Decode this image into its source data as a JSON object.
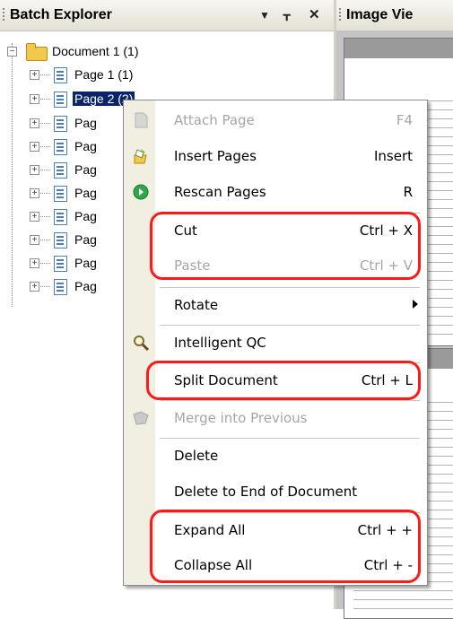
{
  "batch_explorer": {
    "title": "Batch Explorer",
    "dropdown_icon": "▼",
    "pin_icon": "ᚁ",
    "close_icon": "✕"
  },
  "image_viewer": {
    "title": "Image Vie"
  },
  "tree": {
    "root_label": "Document 1 (1)",
    "pages": [
      {
        "label": "Page 1 (1)"
      },
      {
        "label": "Page 2 (2)"
      },
      {
        "label": "Pag"
      },
      {
        "label": "Pag"
      },
      {
        "label": "Pag"
      },
      {
        "label": "Pag"
      },
      {
        "label": "Pag"
      },
      {
        "label": "Pag"
      },
      {
        "label": "Pag"
      },
      {
        "label": "Pag"
      }
    ]
  },
  "context_menu": {
    "items": [
      {
        "label": "Attach Page",
        "shortcut": "F4",
        "icon": "attach-page-icon",
        "disabled": true
      },
      {
        "label": "Insert Pages",
        "shortcut": "Insert",
        "icon": "insert-pages-icon"
      },
      {
        "label": "Rescan Pages",
        "shortcut": "R",
        "icon": "rescan-pages-icon"
      },
      {
        "label": "Cut",
        "shortcut": "Ctrl + X"
      },
      {
        "label": "Paste",
        "shortcut": "Ctrl + V",
        "disabled": true
      },
      {
        "label": "Rotate",
        "submenu": true
      },
      {
        "label": "Intelligent QC",
        "icon": "intelligent-qc-icon"
      },
      {
        "label": "Split Document",
        "shortcut": "Ctrl + L"
      },
      {
        "label": "Merge into Previous",
        "icon": "merge-icon",
        "disabled": true
      },
      {
        "label": "Delete"
      },
      {
        "label": "Delete to End of Document"
      },
      {
        "label": "Expand All",
        "shortcut": "Ctrl + +"
      },
      {
        "label": "Collapse All",
        "shortcut": "Ctrl + -"
      }
    ]
  },
  "colors": {
    "highlight": "#ff1a1a",
    "selection": "#0a246a",
    "menu_strip": "#f1efe2"
  }
}
